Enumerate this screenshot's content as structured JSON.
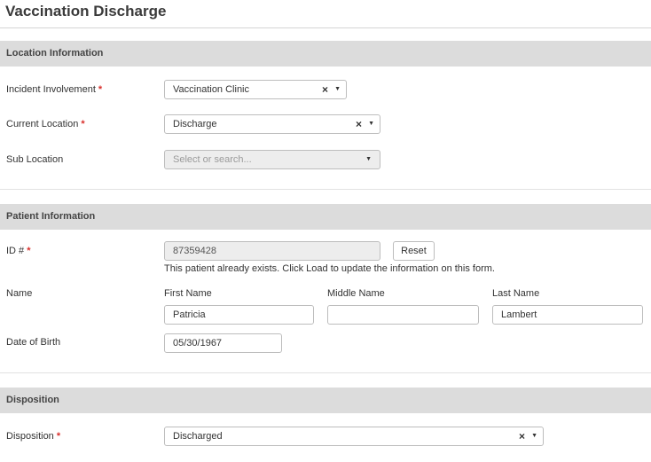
{
  "page": {
    "title": "Vaccination Discharge"
  },
  "location": {
    "heading": "Location Information",
    "incident": {
      "label": "Incident Involvement",
      "required": "*",
      "value": "Vaccination Clinic",
      "clear": "×",
      "caret": "▼"
    },
    "current": {
      "label": "Current Location",
      "required": "*",
      "value": "Discharge",
      "clear": "×",
      "caret": "▼"
    },
    "sub": {
      "label": "Sub Location",
      "placeholder": "Select or search...",
      "caret": "▼"
    }
  },
  "patient": {
    "heading": "Patient Information",
    "id": {
      "label": "ID #",
      "required": "*",
      "value": "87359428",
      "reset_label": "Reset",
      "note": "This patient already exists. Click Load to update the information on this form."
    },
    "name": {
      "label": "Name",
      "first_label": "First Name",
      "first_value": "Patricia",
      "middle_label": "Middle Name",
      "middle_value": "",
      "last_label": "Last Name",
      "last_value": "Lambert"
    },
    "dob": {
      "label": "Date of Birth",
      "value": "05/30/1967"
    }
  },
  "disposition": {
    "heading": "Disposition",
    "field": {
      "label": "Disposition",
      "required": "*",
      "value": "Discharged",
      "clear": "×",
      "caret": "▼"
    }
  }
}
